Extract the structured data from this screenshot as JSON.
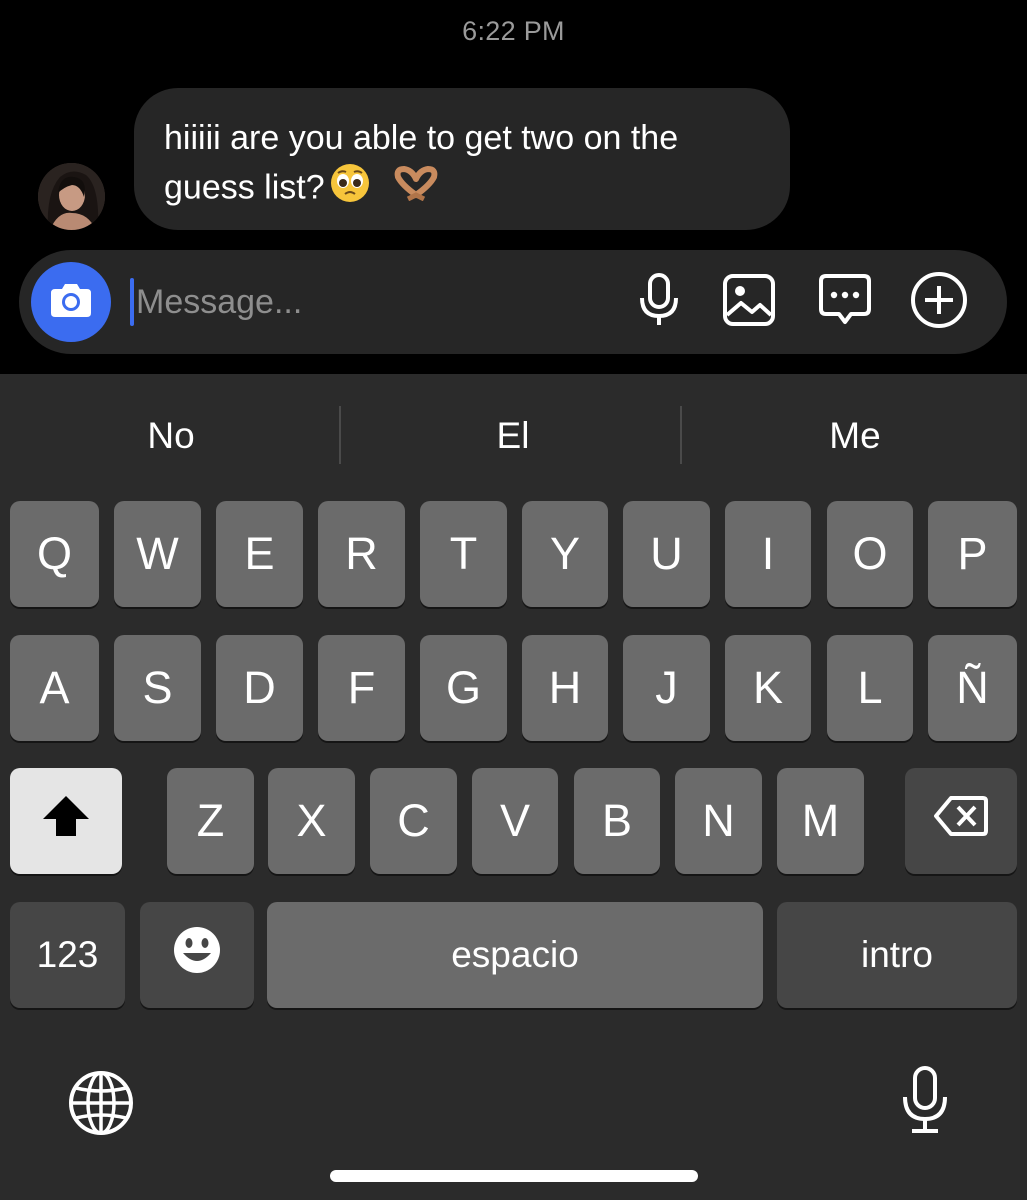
{
  "thread": {
    "timestamp": "6:22 PM",
    "message": {
      "text": "hiiiii are you able to get two on the guess list?",
      "emojis": [
        "pleading-face-emoji",
        "heart-hands-emoji"
      ]
    }
  },
  "composer": {
    "placeholder": "Message...",
    "icons": [
      "camera-icon",
      "microphone-icon",
      "gallery-icon",
      "sticker-icon",
      "plus-icon"
    ]
  },
  "keyboard": {
    "suggestions": [
      "No",
      "El",
      "Me"
    ],
    "row1": [
      "Q",
      "W",
      "E",
      "R",
      "T",
      "Y",
      "U",
      "I",
      "O",
      "P"
    ],
    "row2": [
      "A",
      "S",
      "D",
      "F",
      "G",
      "H",
      "J",
      "K",
      "L",
      "Ñ"
    ],
    "row3": [
      "Z",
      "X",
      "C",
      "V",
      "B",
      "N",
      "M"
    ],
    "numbers_label": "123",
    "space_label": "espacio",
    "return_label": "intro"
  },
  "colors": {
    "accent": "#3b6cf0",
    "bubble": "#262626",
    "key": "#6b6b6b",
    "key_dark": "#464646"
  }
}
